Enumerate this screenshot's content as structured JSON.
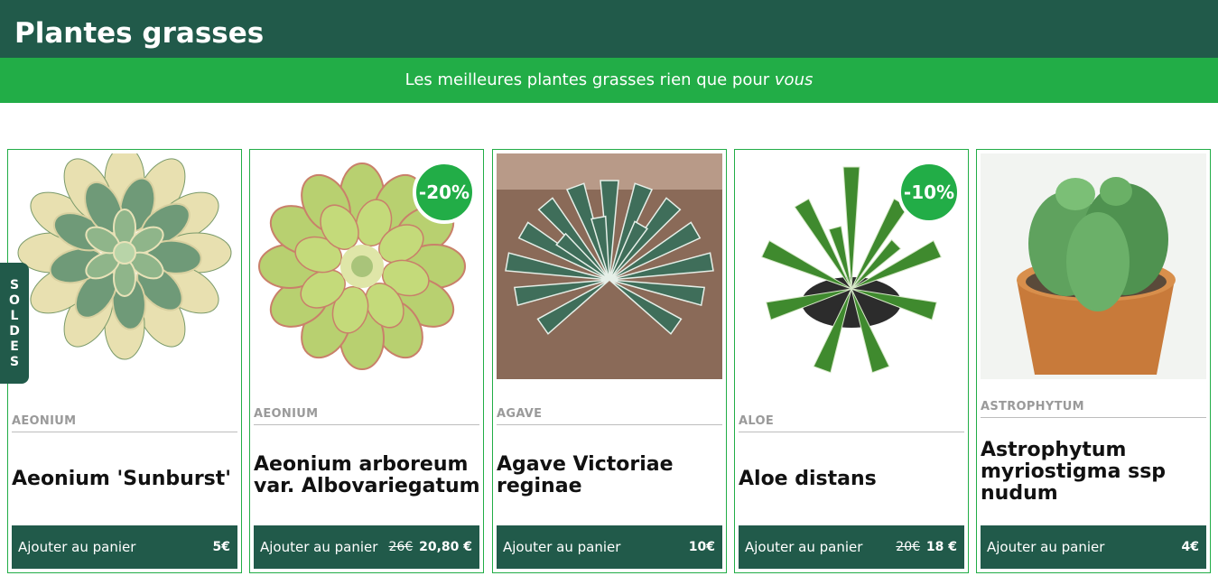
{
  "header": {
    "title": "Plantes grasses"
  },
  "banner": {
    "text": "Les meilleures plantes grasses rien que pour",
    "emphasis": "vous"
  },
  "sale_tab": {
    "letters": [
      "S",
      "O",
      "L",
      "D",
      "E",
      "S"
    ]
  },
  "products": [
    {
      "category": "AEONIUM",
      "name": "Aeonium 'Sunburst'",
      "cart_label": "Ajouter au panier",
      "old_price": "",
      "price": "5€",
      "discount": ""
    },
    {
      "category": "AEONIUM",
      "name": "Aeonium arboreum var. Albovariegatum",
      "cart_label": "Ajouter au panier",
      "old_price": "26€",
      "price": "20,80 €",
      "discount": "-20%"
    },
    {
      "category": "AGAVE",
      "name": "Agave Victoriae reginae",
      "cart_label": "Ajouter au panier",
      "old_price": "",
      "price": "10€",
      "discount": ""
    },
    {
      "category": "ALOE",
      "name": "Aloe distans",
      "cart_label": "Ajouter au panier",
      "old_price": "20€",
      "price": "18 €",
      "discount": "-10%"
    },
    {
      "category": "ASTROPHYTUM",
      "name": "Astrophytum myriostigma ssp nudum",
      "cart_label": "Ajouter au panier",
      "old_price": "",
      "price": "4€",
      "discount": ""
    }
  ],
  "colors": {
    "dark_green": "#215a4a",
    "accent_green": "#22ad47",
    "category_grey": "#9a9a9a"
  }
}
